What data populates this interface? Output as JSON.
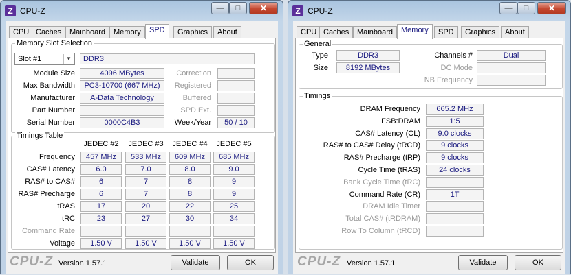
{
  "left": {
    "title": "CPU-Z",
    "tabs": [
      "CPU",
      "Caches",
      "Mainboard",
      "Memory",
      "SPD",
      "Graphics",
      "About"
    ],
    "slot_group_title": "Memory Slot Selection",
    "slot_selected": "Slot #1",
    "memory_type": "DDR3",
    "rows": {
      "module_size": {
        "label": "Module Size",
        "value": "4096 MBytes"
      },
      "max_bandwidth": {
        "label": "Max Bandwidth",
        "value": "PC3-10700 (667 MHz)"
      },
      "manufacturer": {
        "label": "Manufacturer",
        "value": "A-Data Technology"
      },
      "part_number": {
        "label": "Part Number",
        "value": ""
      },
      "serial_number": {
        "label": "Serial Number",
        "value": "0000C4B3"
      }
    },
    "right_rows": {
      "correction": {
        "label": "Correction",
        "value": ""
      },
      "registered": {
        "label": "Registered",
        "value": ""
      },
      "buffered": {
        "label": "Buffered",
        "value": ""
      },
      "spd_ext": {
        "label": "SPD Ext.",
        "value": ""
      },
      "week_year": {
        "label": "Week/Year",
        "value": "50 / 10"
      }
    },
    "timings_title": "Timings Table",
    "timing_columns": [
      "JEDEC #2",
      "JEDEC #3",
      "JEDEC #4",
      "JEDEC #5"
    ],
    "timing_rows": [
      {
        "label": "Frequency",
        "values": [
          "457 MHz",
          "533 MHz",
          "609 MHz",
          "685 MHz"
        ]
      },
      {
        "label": "CAS# Latency",
        "values": [
          "6.0",
          "7.0",
          "8.0",
          "9.0"
        ]
      },
      {
        "label": "RAS# to CAS#",
        "values": [
          "6",
          "7",
          "8",
          "9"
        ]
      },
      {
        "label": "RAS# Precharge",
        "values": [
          "6",
          "7",
          "8",
          "9"
        ]
      },
      {
        "label": "tRAS",
        "values": [
          "17",
          "20",
          "22",
          "25"
        ]
      },
      {
        "label": "tRC",
        "values": [
          "23",
          "27",
          "30",
          "34"
        ]
      },
      {
        "label": "Command Rate",
        "values": [
          "",
          "",
          "",
          ""
        ]
      },
      {
        "label": "Voltage",
        "values": [
          "1.50 V",
          "1.50 V",
          "1.50 V",
          "1.50 V"
        ]
      }
    ],
    "brand": "CPU-Z",
    "version": "Version 1.57.1",
    "validate": "Validate",
    "ok": "OK"
  },
  "right": {
    "title": "CPU-Z",
    "tabs": [
      "CPU",
      "Caches",
      "Mainboard",
      "Memory",
      "SPD",
      "Graphics",
      "About"
    ],
    "general_title": "General",
    "type": {
      "label": "Type",
      "value": "DDR3"
    },
    "size": {
      "label": "Size",
      "value": "8192 MBytes"
    },
    "channels": {
      "label": "Channels #",
      "value": "Dual"
    },
    "dc_mode": {
      "label": "DC Mode",
      "value": ""
    },
    "nb_frequency": {
      "label": "NB Frequency",
      "value": ""
    },
    "timings_title": "Timings",
    "timing_rows": [
      {
        "label": "DRAM Frequency",
        "value": "665.2 MHz",
        "enabled": true
      },
      {
        "label": "FSB:DRAM",
        "value": "1:5",
        "enabled": true
      },
      {
        "label": "CAS# Latency (CL)",
        "value": "9.0 clocks",
        "enabled": true
      },
      {
        "label": "RAS# to CAS# Delay (tRCD)",
        "value": "9 clocks",
        "enabled": true
      },
      {
        "label": "RAS# Precharge (tRP)",
        "value": "9 clocks",
        "enabled": true
      },
      {
        "label": "Cycle Time (tRAS)",
        "value": "24 clocks",
        "enabled": true
      },
      {
        "label": "Bank Cycle Time (tRC)",
        "value": "",
        "enabled": false
      },
      {
        "label": "Command Rate (CR)",
        "value": "1T",
        "enabled": true
      },
      {
        "label": "DRAM Idle Timer",
        "value": "",
        "enabled": false
      },
      {
        "label": "Total CAS# (tRDRAM)",
        "value": "",
        "enabled": false
      },
      {
        "label": "Row To Column (tRCD)",
        "value": "",
        "enabled": false
      }
    ],
    "brand": "CPU-Z",
    "version": "Version 1.57.1",
    "validate": "Validate",
    "ok": "OK"
  }
}
